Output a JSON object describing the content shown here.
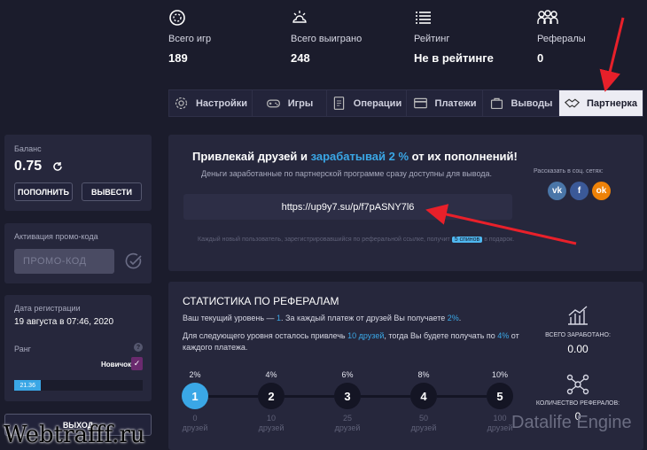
{
  "stats": [
    {
      "icon": "gamepad-circle-icon",
      "label": "Всего игр",
      "value": "189"
    },
    {
      "icon": "sun-cloud-icon",
      "label": "Всего выиграно",
      "value": "248"
    },
    {
      "icon": "list-icon",
      "label": "Рейтинг",
      "value": "Не в рейтинге"
    },
    {
      "icon": "users-icon",
      "label": "Рефералы",
      "value": "0"
    }
  ],
  "tabs": [
    {
      "label": "Настройки",
      "icon": "gear-icon"
    },
    {
      "label": "Игры",
      "icon": "gamepad-icon"
    },
    {
      "label": "Операции",
      "icon": "document-icon"
    },
    {
      "label": "Платежи",
      "icon": "card-icon"
    },
    {
      "label": "Выводы",
      "icon": "bag-icon"
    },
    {
      "label": "Партнерка",
      "icon": "handshake-icon",
      "active": true
    }
  ],
  "balance": {
    "label": "Баланс",
    "value": "0.75",
    "deposit": "ПОПОЛНИТЬ",
    "withdraw": "ВЫВЕСТИ"
  },
  "promo": {
    "label": "Активация промо-кода",
    "placeholder": "ПРОМО-КОД"
  },
  "profile": {
    "reg_label": "Дата регистрации",
    "reg_value": "19 августа в 07:46, 2020",
    "rank_label": "Ранг",
    "rank_name": "Новичок",
    "rank_help": "?",
    "progress_text": "21.36",
    "progress_fraction": 0.21
  },
  "logout": "ВЫХОД",
  "partner": {
    "title_a": "Привлекай друзей и ",
    "title_b": "зарабатывай 2 %",
    "title_c": " от их пополнений!",
    "subtitle": "Деньги заработанные по партнерской программе сразу доступны для вывода.",
    "link": "https://up9y7.su/p/f7pASNY7l6",
    "share_label": "Рассказать в соц. сетях:",
    "social": [
      "vk",
      "f",
      "ok"
    ],
    "note_a": "Каждый новый пользователь, зарегистрировавшийся по реферальной ссылке, получит",
    "note_badge": "5 спинов",
    "note_b": "в подарок."
  },
  "ref_stats": {
    "title": "СТАТИСТИКА ПО РЕФЕРАЛАМ",
    "line1_a": "Ваш текущий уровень — ",
    "line1_level": "1",
    "line1_b": ". За каждый платеж от друзей Вы получаете ",
    "line1_pct": "2%",
    "line1_c": ".",
    "line2_a": "Для следующего уровня осталось привлечь ",
    "line2_friends": "10 друзей",
    "line2_b": ", тогда Вы будете получать по ",
    "line2_pct": "4%",
    "line2_c": " от каждого платежа.",
    "earned_label": "ВСЕГО ЗАРАБОТАНО:",
    "earned_value": "0.00",
    "refs_label": "КОЛИЧЕСТВО РЕФЕРАЛОВ:",
    "refs_value": "0",
    "levels": [
      {
        "pct": "2%",
        "num": "1",
        "min": "0",
        "unit": "друзей",
        "active": true
      },
      {
        "pct": "4%",
        "num": "2",
        "min": "10",
        "unit": "друзей"
      },
      {
        "pct": "6%",
        "num": "3",
        "min": "25",
        "unit": "друзей"
      },
      {
        "pct": "8%",
        "num": "4",
        "min": "50",
        "unit": "друзей"
      },
      {
        "pct": "10%",
        "num": "5",
        "min": "100",
        "unit": "друзей"
      }
    ]
  },
  "watermarks": {
    "left": "Webtrafff.ru",
    "right": "Datalife Engine"
  },
  "colors": {
    "accent": "#3aa7e6",
    "bg": "#1b1c2c",
    "card": "#26273c",
    "arrow": "#e8202a",
    "badge": "#4fb8f0"
  }
}
